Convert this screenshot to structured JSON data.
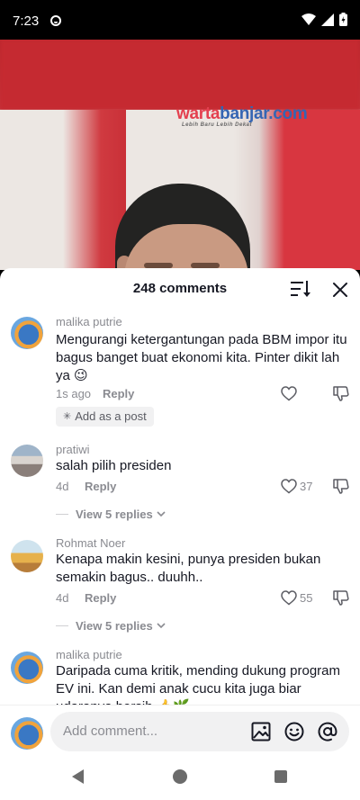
{
  "status_bar": {
    "time": "7:23"
  },
  "video": {
    "watermark_brand_a": "warta",
    "watermark_brand_b": "banjar.com",
    "watermark_tagline": "Lebih Baru Lebih Dekat"
  },
  "sheet": {
    "title": "248 comments"
  },
  "comments": [
    {
      "username": "malika putrie",
      "text": "Mengurangi ketergantungan pada BBM impor itu bagus banget buat ekonomi kita. Pinter dikit lah ya 😉",
      "time": "1s ago",
      "reply_label": "Reply",
      "like_count": "",
      "chip": "Add as a post"
    },
    {
      "username": "pratiwi",
      "text": "salah pilih presiden",
      "time": "4d",
      "reply_label": "Reply",
      "like_count": "37",
      "view_replies": "View 5 replies"
    },
    {
      "username": "Rohmat Noer",
      "text": "Kenapa makin kesini, punya presiden bukan semakin bagus.. duuhh..",
      "time": "4d",
      "reply_label": "Reply",
      "like_count": "55",
      "view_replies": "View 5 replies"
    },
    {
      "username": "malika putrie",
      "text": "Daripada cuma kritik, mending dukung program EV ini. Kan demi anak cucu kita juga biar udaranya bersih 👍🌿"
    }
  ],
  "composer": {
    "placeholder": "Add comment..."
  },
  "icons": {
    "sort": "sort-icon",
    "close": "close-icon",
    "like": "heart-outline-icon",
    "dislike": "thumbs-down-icon",
    "image": "image-icon",
    "emoji": "emoji-icon",
    "mention": "at-icon"
  }
}
